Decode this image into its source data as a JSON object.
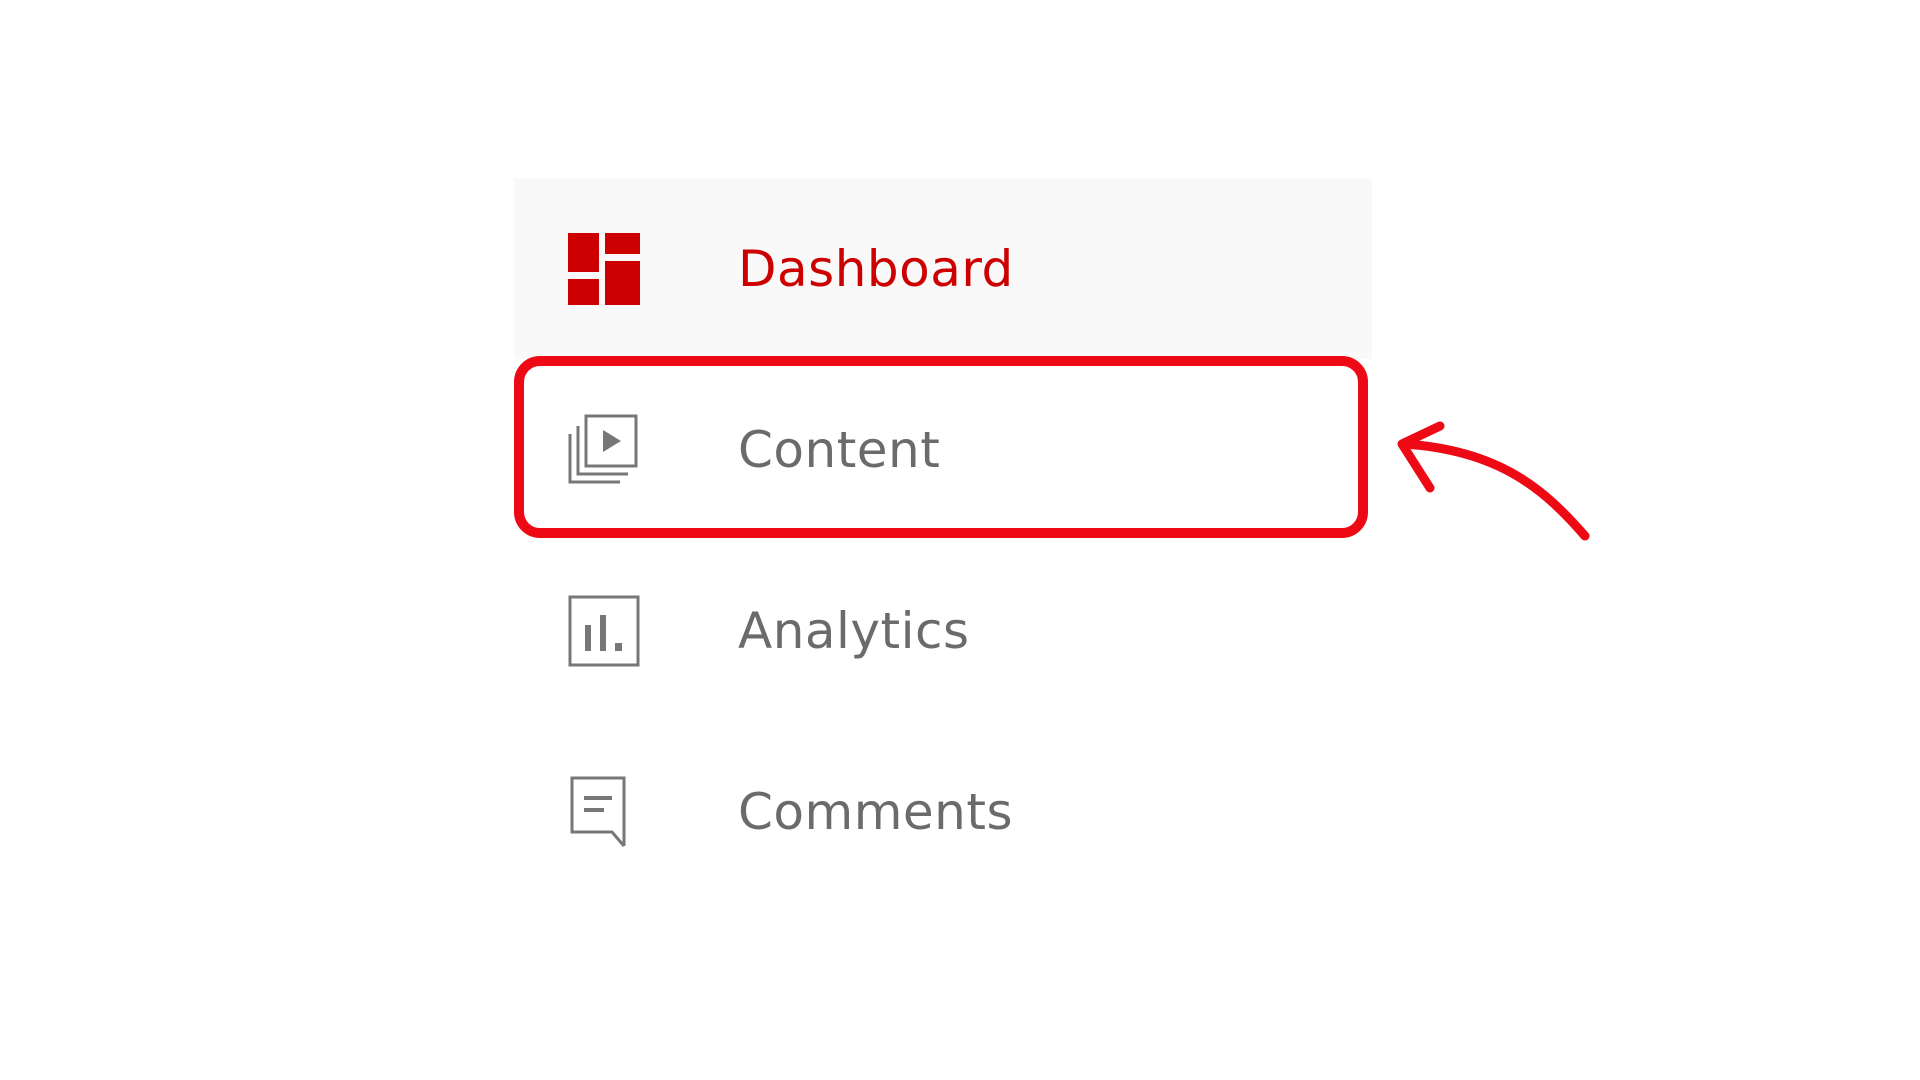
{
  "sidebar": {
    "items": [
      {
        "label": "Dashboard",
        "icon": "dashboard-icon",
        "active": true
      },
      {
        "label": "Content",
        "icon": "content-icon",
        "active": false
      },
      {
        "label": "Analytics",
        "icon": "analytics-icon",
        "active": false
      },
      {
        "label": "Comments",
        "icon": "comments-icon",
        "active": false
      }
    ]
  },
  "annotation": {
    "highlighted_item": "Content",
    "color": "#ee0a14"
  },
  "colors": {
    "active": "#cc0000",
    "inactive_text": "#6b6b6b",
    "icon_stroke": "#777777",
    "active_background": "#f9f9f9"
  }
}
